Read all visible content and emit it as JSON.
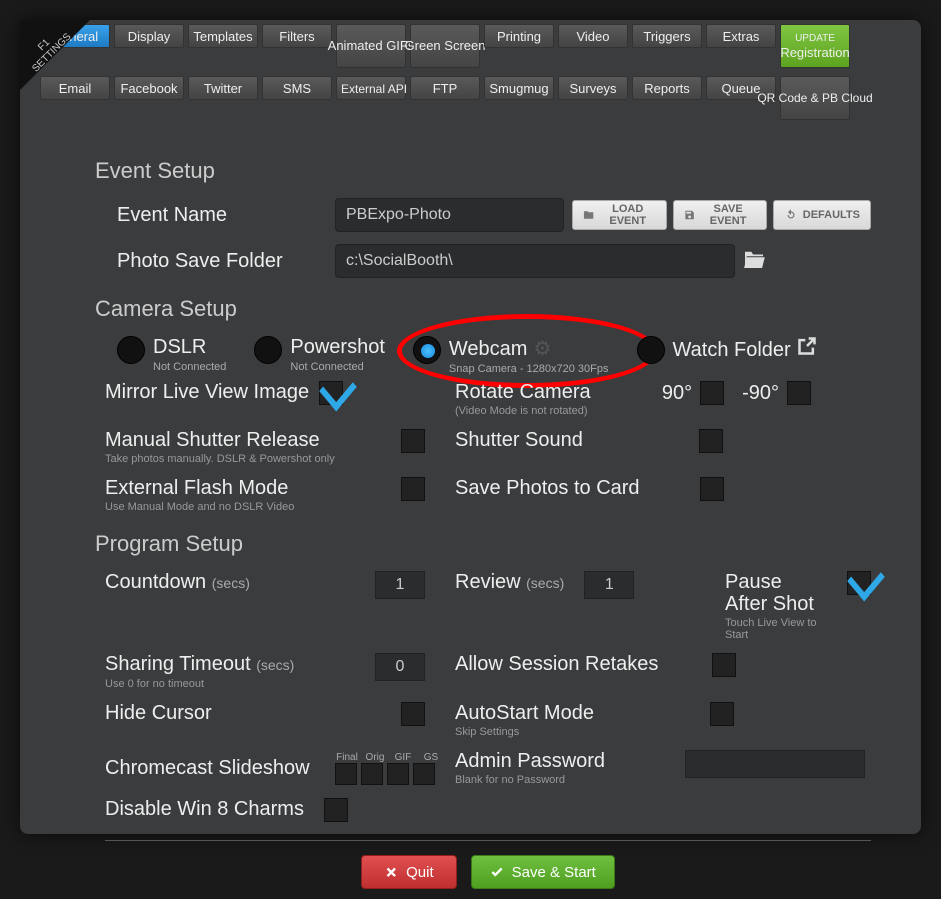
{
  "corner": {
    "line1": "F1",
    "line2": "SETTINGS"
  },
  "tabs_row1": [
    "General",
    "Display",
    "Templates",
    "Filters",
    "Animated GIFs",
    "Green Screen",
    "Printing",
    "Video",
    "Triggers",
    "Extras"
  ],
  "tabs_row2": [
    "Email",
    "Facebook",
    "Twitter",
    "SMS",
    "External API",
    "FTP",
    "Smugmug",
    "Surveys",
    "Reports",
    "Queue",
    "QR Code & PB Cloud"
  ],
  "update_tab": {
    "small": "UPDATE",
    "big": "Registration"
  },
  "event": {
    "title": "Event Setup",
    "name_label": "Event Name",
    "name_value": "PBExpo-Photo",
    "folder_label": "Photo Save Folder",
    "folder_value": "c:\\SocialBooth\\",
    "btn_load": "LOAD EVENT",
    "btn_save": "SAVE EVENT",
    "btn_defaults": "DEFAULTS"
  },
  "camera": {
    "title": "Camera Setup",
    "dslr": "DSLR",
    "dslr_sub": "Not Connected",
    "powershot": "Powershot",
    "powershot_sub": "Not Connected",
    "webcam": "Webcam",
    "webcam_sub": "Snap Camera - 1280x720 30Fps",
    "watch": "Watch Folder",
    "mirror": "Mirror Live View Image",
    "rotate": "Rotate Camera",
    "rotate_sub": "(Video Mode is not rotated)",
    "rot90": "90°",
    "rotm90": "-90°",
    "shutter_rel": "Manual Shutter Release",
    "shutter_rel_sub": "Take photos manually.  DSLR & Powershot only",
    "shutter_snd": "Shutter Sound",
    "flash": "External Flash Mode",
    "flash_sub": "Use Manual Mode and no DSLR Video",
    "save_card": "Save Photos to Card"
  },
  "program": {
    "title": "Program Setup",
    "countdown": "Countdown",
    "secs": "(secs)",
    "countdown_val": "1",
    "review": "Review",
    "review_val": "1",
    "pause": "Pause After Shot",
    "pause_sub": "Touch Live View to Start",
    "sharing": "Sharing Timeout",
    "sharing_sub": "Use 0 for no timeout",
    "sharing_val": "0",
    "retakes": "Allow Session Retakes",
    "hide": "Hide Cursor",
    "autostart": "AutoStart Mode",
    "autostart_sub": "Skip Settings",
    "chrome": "Chromecast Slideshow",
    "cc_labels": [
      "Final",
      "Orig",
      "GIF",
      "GS"
    ],
    "admin": "Admin Password",
    "admin_sub": "Blank for no Password",
    "win8": "Disable Win 8 Charms"
  },
  "footer": {
    "quit": "Quit",
    "save": "Save & Start"
  }
}
